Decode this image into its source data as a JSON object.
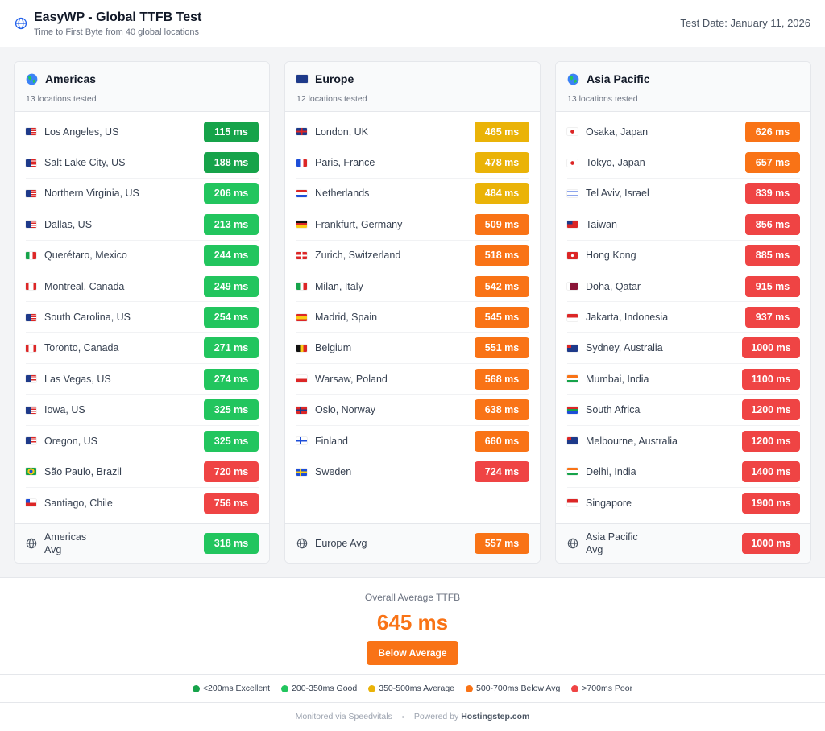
{
  "header": {
    "title": "EasyWP - Global TTFB Test",
    "subtitle": "Time to First Byte from 40 global locations",
    "test_date": "Test Date: January 11, 2026"
  },
  "colors": {
    "excellent": "#16a34a",
    "good": "#22c55e",
    "average": "#eab308",
    "below": "#f97316",
    "poor": "#ef4444"
  },
  "regions": [
    {
      "name": "Americas",
      "icon": "globe-americas-icon",
      "count": "13 locations tested",
      "locations": [
        {
          "flag": "us",
          "name": "Los Angeles, US",
          "value": "115 ms",
          "rating": "excellent"
        },
        {
          "flag": "us",
          "name": "Salt Lake City, US",
          "value": "188 ms",
          "rating": "excellent"
        },
        {
          "flag": "us",
          "name": "Northern Virginia, US",
          "value": "206 ms",
          "rating": "good"
        },
        {
          "flag": "us",
          "name": "Dallas, US",
          "value": "213 ms",
          "rating": "good"
        },
        {
          "flag": "mx",
          "name": "Querétaro, Mexico",
          "value": "244 ms",
          "rating": "good"
        },
        {
          "flag": "ca",
          "name": "Montreal, Canada",
          "value": "249 ms",
          "rating": "good"
        },
        {
          "flag": "us",
          "name": "South Carolina, US",
          "value": "254 ms",
          "rating": "good"
        },
        {
          "flag": "ca",
          "name": "Toronto, Canada",
          "value": "271 ms",
          "rating": "good"
        },
        {
          "flag": "us",
          "name": "Las Vegas, US",
          "value": "274 ms",
          "rating": "good"
        },
        {
          "flag": "us",
          "name": "Iowa, US",
          "value": "325 ms",
          "rating": "good"
        },
        {
          "flag": "us",
          "name": "Oregon, US",
          "value": "325 ms",
          "rating": "good"
        },
        {
          "flag": "br",
          "name": "São Paulo, Brazil",
          "value": "720 ms",
          "rating": "poor"
        },
        {
          "flag": "cl",
          "name": "Santiago, Chile",
          "value": "756 ms",
          "rating": "poor"
        }
      ],
      "avg_label": "Americas Avg",
      "avg_value": "318 ms",
      "avg_rating": "good"
    },
    {
      "name": "Europe",
      "icon": "eu-flag-icon",
      "count": "12 locations tested",
      "locations": [
        {
          "flag": "uk",
          "name": "London, UK",
          "value": "465 ms",
          "rating": "average"
        },
        {
          "flag": "fr",
          "name": "Paris, France",
          "value": "478 ms",
          "rating": "average"
        },
        {
          "flag": "nl",
          "name": "Netherlands",
          "value": "484 ms",
          "rating": "average"
        },
        {
          "flag": "de",
          "name": "Frankfurt, Germany",
          "value": "509 ms",
          "rating": "below"
        },
        {
          "flag": "ch",
          "name": "Zurich, Switzerland",
          "value": "518 ms",
          "rating": "below"
        },
        {
          "flag": "it",
          "name": "Milan, Italy",
          "value": "542 ms",
          "rating": "below"
        },
        {
          "flag": "es",
          "name": "Madrid, Spain",
          "value": "545 ms",
          "rating": "below"
        },
        {
          "flag": "be",
          "name": "Belgium",
          "value": "551 ms",
          "rating": "below"
        },
        {
          "flag": "pl",
          "name": "Warsaw, Poland",
          "value": "568 ms",
          "rating": "below"
        },
        {
          "flag": "no",
          "name": "Oslo, Norway",
          "value": "638 ms",
          "rating": "below"
        },
        {
          "flag": "fi",
          "name": "Finland",
          "value": "660 ms",
          "rating": "below"
        },
        {
          "flag": "se",
          "name": "Sweden",
          "value": "724 ms",
          "rating": "poor"
        }
      ],
      "avg_label": "Europe Avg",
      "avg_value": "557 ms",
      "avg_rating": "below"
    },
    {
      "name": "Asia Pacific",
      "icon": "globe-asia-icon",
      "count": "13 locations tested",
      "locations": [
        {
          "flag": "jp",
          "name": "Osaka, Japan",
          "value": "626 ms",
          "rating": "below"
        },
        {
          "flag": "jp",
          "name": "Tokyo, Japan",
          "value": "657 ms",
          "rating": "below"
        },
        {
          "flag": "il",
          "name": "Tel Aviv, Israel",
          "value": "839 ms",
          "rating": "poor"
        },
        {
          "flag": "tw",
          "name": "Taiwan",
          "value": "856 ms",
          "rating": "poor"
        },
        {
          "flag": "hk",
          "name": "Hong Kong",
          "value": "885 ms",
          "rating": "poor"
        },
        {
          "flag": "qa",
          "name": "Doha, Qatar",
          "value": "915 ms",
          "rating": "poor"
        },
        {
          "flag": "id",
          "name": "Jakarta, Indonesia",
          "value": "937 ms",
          "rating": "poor"
        },
        {
          "flag": "au",
          "name": "Sydney, Australia",
          "value": "1000 ms",
          "rating": "poor"
        },
        {
          "flag": "in",
          "name": "Mumbai, India",
          "value": "1100 ms",
          "rating": "poor"
        },
        {
          "flag": "za",
          "name": "South Africa",
          "value": "1200 ms",
          "rating": "poor"
        },
        {
          "flag": "au",
          "name": "Melbourne, Australia",
          "value": "1200 ms",
          "rating": "poor"
        },
        {
          "flag": "in",
          "name": "Delhi, India",
          "value": "1400 ms",
          "rating": "poor"
        },
        {
          "flag": "sg",
          "name": "Singapore",
          "value": "1900 ms",
          "rating": "poor"
        }
      ],
      "avg_label": "Asia Pacific Avg",
      "avg_value": "1000 ms",
      "avg_rating": "poor"
    }
  ],
  "overall": {
    "label": "Overall Average TTFB",
    "value": "645 ms",
    "status": "Below Average"
  },
  "legend": [
    {
      "label": "<200ms Excellent",
      "rating": "excellent"
    },
    {
      "label": "200-350ms Good",
      "rating": "good"
    },
    {
      "label": "350-500ms Average",
      "rating": "average"
    },
    {
      "label": "500-700ms Below Avg",
      "rating": "below"
    },
    {
      "label": ">700ms Poor",
      "rating": "poor"
    }
  ],
  "footer": {
    "monitored": "Monitored via Speedvitals",
    "powered_prefix": "Powered by ",
    "powered_brand": "Hostingstep.com"
  }
}
